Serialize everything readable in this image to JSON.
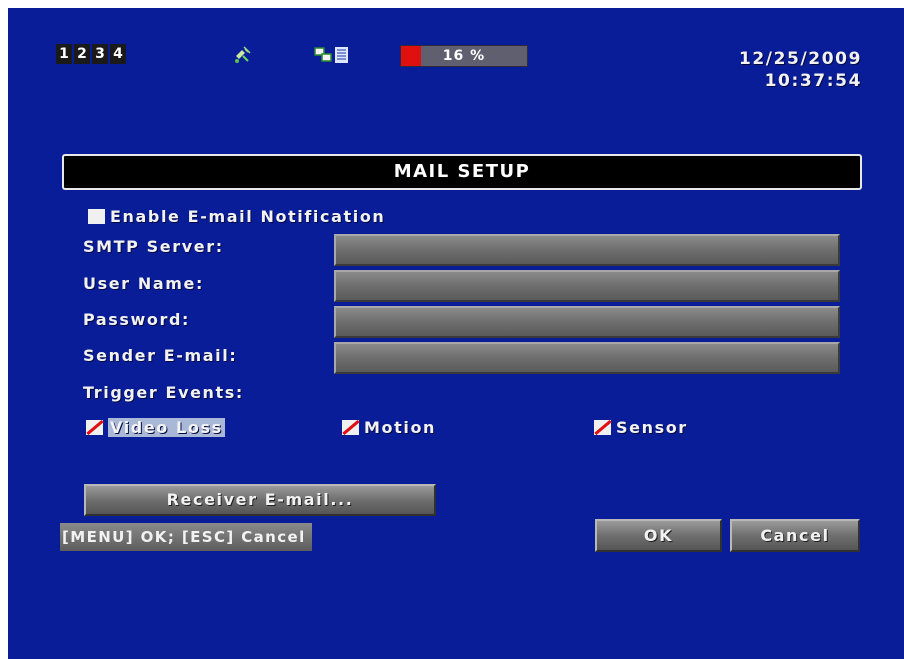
{
  "status_bar": {
    "channels": [
      "1",
      "2",
      "3",
      "4"
    ],
    "record_icon": "satellite-icon",
    "network_icon": "network-icon",
    "hdd_usage": {
      "text": "16 %",
      "percent": 16
    },
    "date": "12/25/2009",
    "time": "10:37:54"
  },
  "dialog": {
    "title": "MAIL SETUP",
    "enable_label": "Enable E-mail Notification",
    "enable_checked": false,
    "fields": {
      "smtp_label": "SMTP Server:",
      "smtp_value": "",
      "user_label": "User Name:",
      "user_value": "",
      "password_label": "Password:",
      "password_value": "",
      "sender_label": "Sender E-mail:",
      "sender_value": ""
    },
    "trigger_label": "Trigger Events:",
    "triggers": {
      "video_loss": "Video Loss",
      "motion": "Motion",
      "sensor": "Sensor"
    },
    "receiver_button": "Receiver E-mail...",
    "hint": "[MENU] OK; [ESC] Cancel",
    "ok_button": "OK",
    "cancel_button": "Cancel"
  },
  "colors": {
    "background": "#0a1d98",
    "hdd_fill": "#e01010",
    "highlight": "#aab8d8"
  }
}
